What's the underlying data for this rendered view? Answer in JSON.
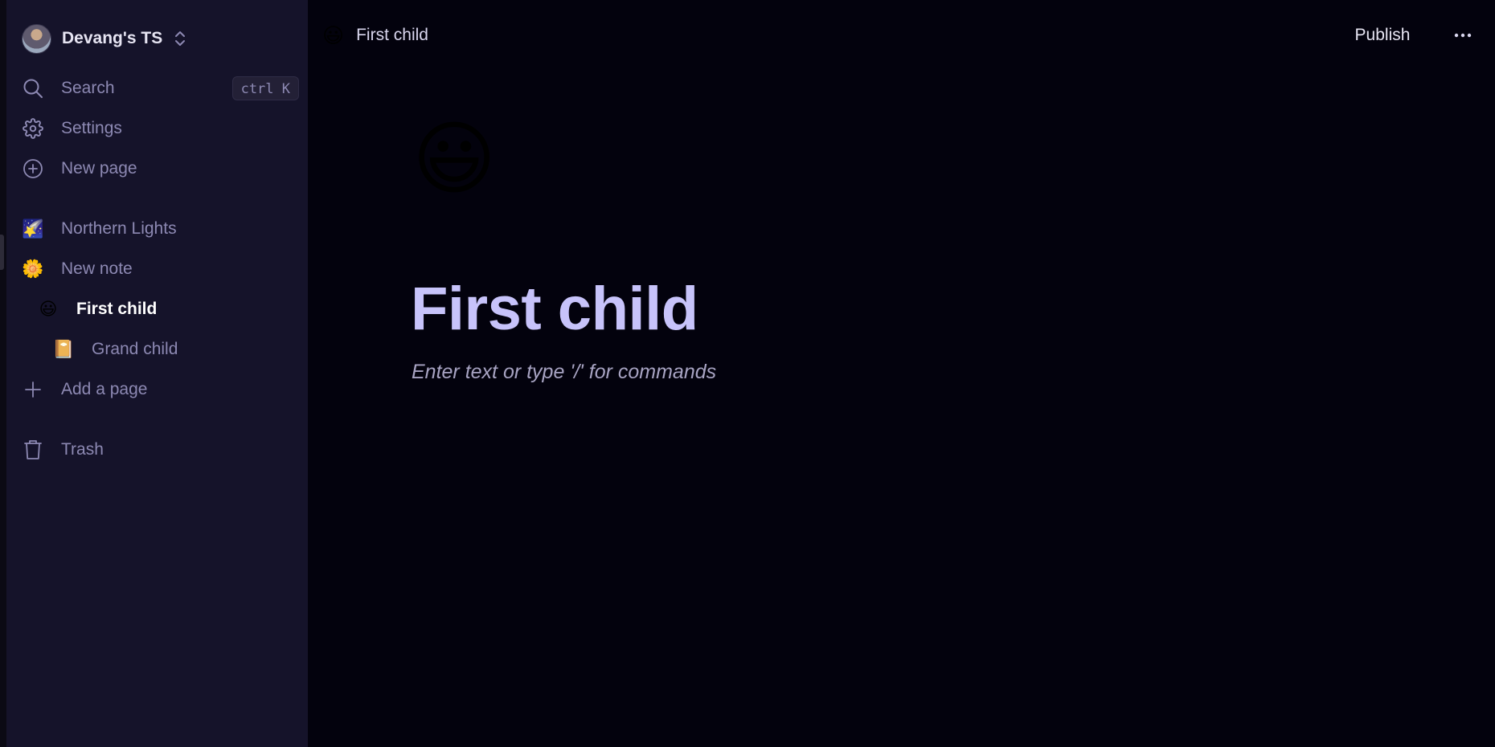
{
  "workspace": {
    "name": "Devang's TS"
  },
  "sidebar": {
    "search": {
      "label": "Search",
      "shortcut": "ctrl K",
      "icon": "search-icon"
    },
    "settings": {
      "label": "Settings",
      "icon": "gear-icon"
    },
    "new_page": {
      "label": "New page",
      "icon": "plus-circle-icon"
    },
    "pages": [
      {
        "emoji": "🌠",
        "label": "Northern Lights",
        "level": 0
      },
      {
        "emoji": "🌼",
        "label": "New note",
        "level": 0
      },
      {
        "emoji": "😃",
        "label": "First child",
        "level": 1,
        "active": true
      },
      {
        "emoji": "📔",
        "label": "Grand child",
        "level": 2
      }
    ],
    "add_page": {
      "label": "Add a page",
      "icon": "plus-icon"
    },
    "trash": {
      "label": "Trash",
      "icon": "trash-icon"
    }
  },
  "topbar": {
    "breadcrumb": {
      "emoji": "😃",
      "label": "First child"
    },
    "publish_label": "Publish",
    "more_icon": "more-horizontal-icon"
  },
  "page": {
    "icon_emoji": "😃",
    "title": "First child",
    "placeholder": "Enter text or type '/' for commands"
  },
  "colors": {
    "sidebar_bg": "#15132a",
    "main_bg": "#03020d",
    "title": "#c7c3fa",
    "muted_text": "#8d89b3"
  }
}
